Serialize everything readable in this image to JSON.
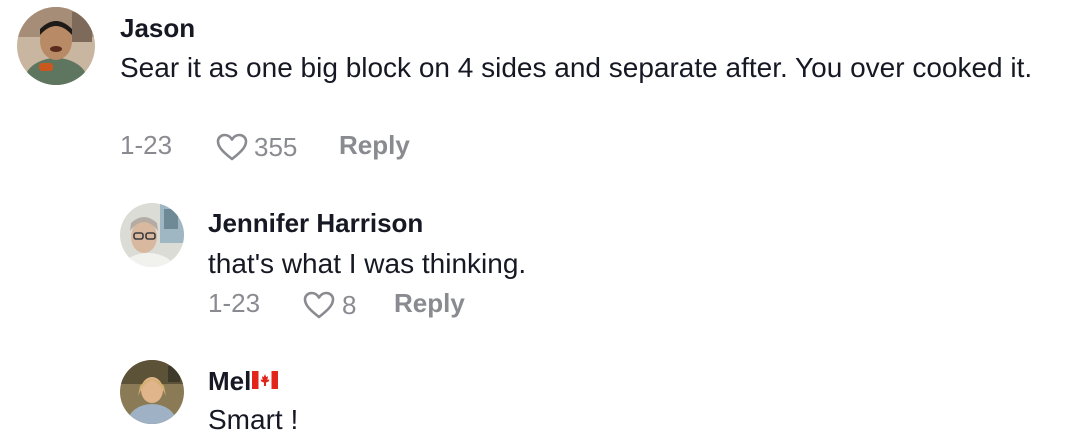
{
  "comments": [
    {
      "username": "Jason",
      "text": "Sear it as one big block on 4 sides and separate after. You over cooked it.",
      "date": "1-23",
      "likes": "355",
      "reply_label": "Reply"
    },
    {
      "username": "Jennifer Harrison",
      "text": "that's what I was thinking.",
      "date": "1-23",
      "likes": "8",
      "reply_label": "Reply"
    },
    {
      "username": "Mel",
      "username_flag": "canada-flag-icon",
      "text": "Smart !"
    }
  ],
  "colors": {
    "text": "#161823",
    "meta": "#8a8b91",
    "flag_red": "#e1251b"
  },
  "icons": {
    "like": "heart-outline-icon"
  }
}
